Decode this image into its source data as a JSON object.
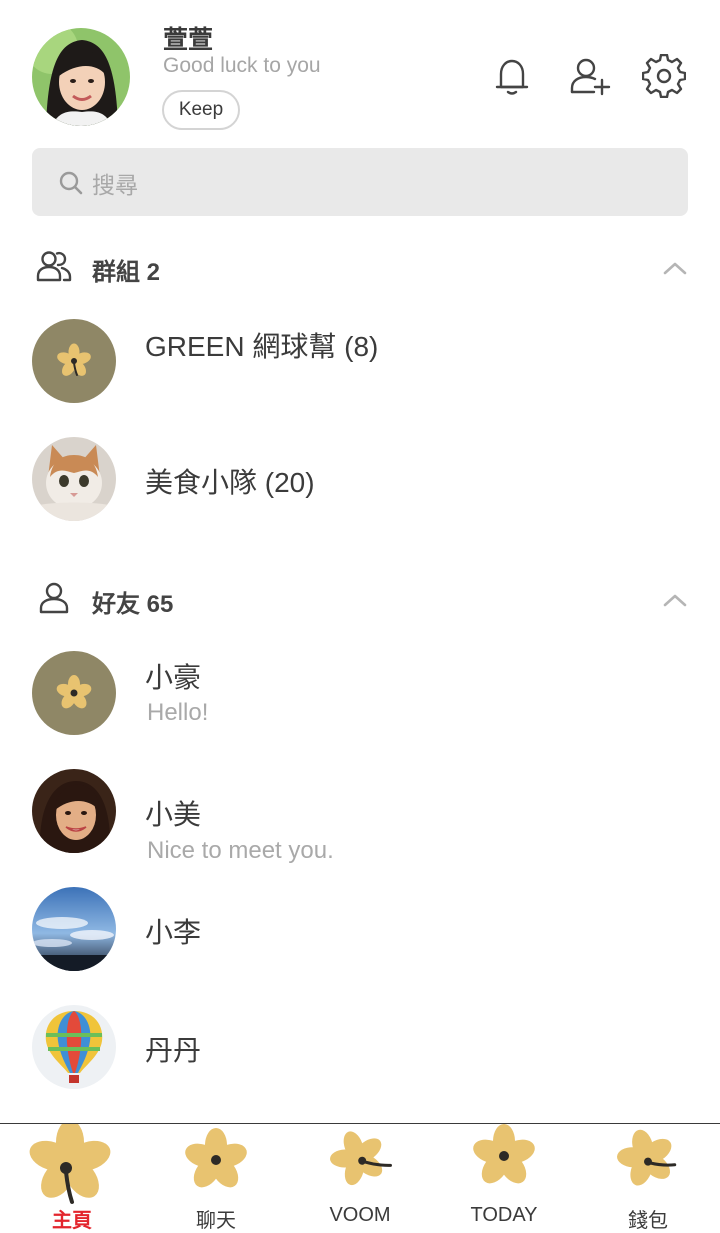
{
  "header": {
    "name": "萱萱",
    "status": "Good luck to you",
    "keep_label": "Keep",
    "icons": [
      "bell-icon",
      "add-friend-icon",
      "gear-icon"
    ]
  },
  "search": {
    "placeholder": "搜尋"
  },
  "groups": {
    "title": "群組 2",
    "items": [
      {
        "name": "GREEN 網球幫 (8)",
        "avatar": "flower"
      },
      {
        "name": "美食小隊 (20)",
        "avatar": "cat-photo"
      }
    ]
  },
  "friends": {
    "title": "好友 65",
    "items": [
      {
        "name": "小豪",
        "message": "Hello!",
        "avatar": "flower"
      },
      {
        "name": "小美",
        "message": "Nice to meet you.",
        "avatar": "woman-photo"
      },
      {
        "name": "小李",
        "message": "",
        "avatar": "sky-photo"
      },
      {
        "name": "丹丹",
        "message": "",
        "avatar": "balloon-photo"
      }
    ]
  },
  "nav": {
    "items": [
      {
        "label": "主頁",
        "active": true
      },
      {
        "label": "聊天",
        "active": false
      },
      {
        "label": "VOOM",
        "active": false
      },
      {
        "label": "TODAY",
        "active": false
      },
      {
        "label": "錢包",
        "active": false
      }
    ]
  },
  "colors": {
    "flower": "#e8c370",
    "flower_avatar_bg": "#8f8766",
    "active_nav": "#e3252d",
    "search_bg": "#e9e9e9"
  }
}
